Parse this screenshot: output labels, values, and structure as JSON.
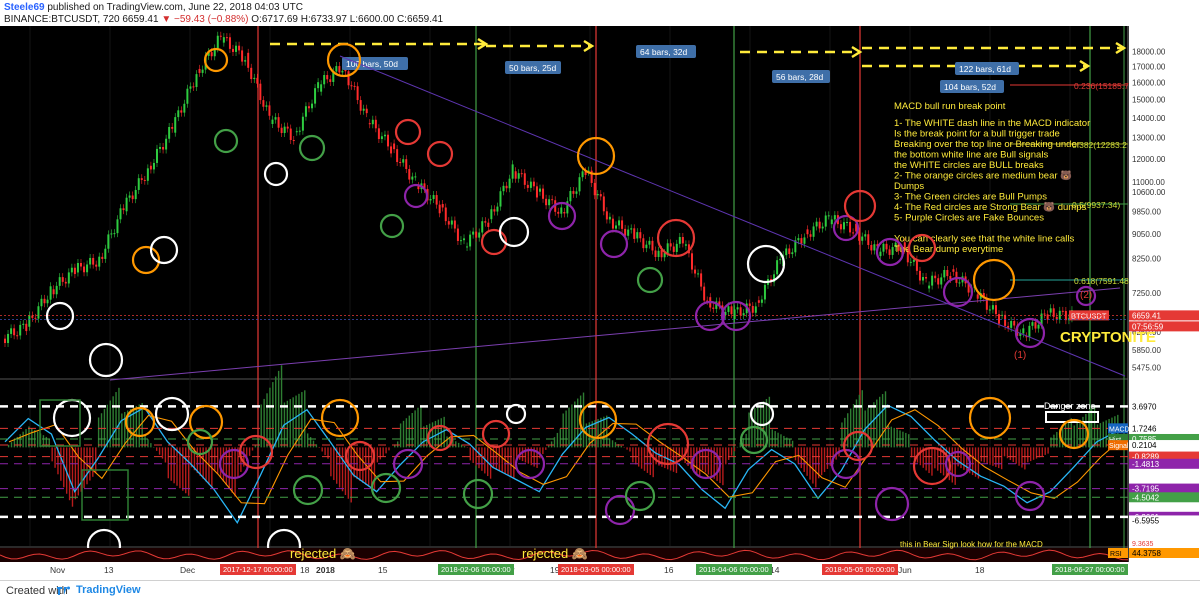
{
  "header": {
    "author": "Steele69",
    "published": "published on TradingView.com, June 22, 2018 04:03 UTC",
    "symbol": "BINANCE:BTCUSDT, 720",
    "last": "6659.41",
    "change": "▼ −59.43 (−0.88%)",
    "ohlc": "O:6717.69 H:6733.97 L:6600.00 C:6659.41"
  },
  "footer": {
    "made_with": "Created with",
    "brand": "TradingView"
  },
  "chart_data": {
    "type": "line",
    "price_axis": [
      "18000.00",
      "16000.00",
      "15000.00",
      "14000.00",
      "13000.00",
      "12000.00",
      "11000.00",
      "10600.00",
      "9850.00",
      "9050.00",
      "8250.00",
      "7950.00",
      "7250.00",
      "6600.00",
      "6250.00",
      "5850.00",
      "5475.00"
    ],
    "price_axis_short": [
      "18000.00",
      "17000.00",
      "16000.00",
      "15000.00",
      "14000.00",
      "13000.00",
      "12000.00",
      "11000.00",
      "10600.00",
      "9850.00",
      "9050.00",
      "8250.00",
      "7250.00",
      "6600.00",
      "6250.00",
      "5850.00",
      "5475.00"
    ],
    "time_axis": [
      "Nov",
      "13",
      "Dec",
      "18",
      "2018",
      "15",
      "Feb",
      "Mar",
      "19",
      "Apr",
      "16",
      "May",
      "14",
      "Jun",
      "18"
    ],
    "time_marks": [
      {
        "label": "2017-12-17 00:00:00",
        "color": "#e53935"
      },
      {
        "label": "2018-02-06 00:00:00",
        "color": "#43a047"
      },
      {
        "label": "2018-03-05 00:00:00",
        "color": "#e53935"
      },
      {
        "label": "2018-04-06 00:00:00",
        "color": "#43a047"
      },
      {
        "label": "2018-05-05 00:00:00",
        "color": "#e53935"
      },
      {
        "label": "2018-06-27 00:00:00",
        "color": "#43a047"
      }
    ],
    "bar_labels": [
      "100 bars, 50d",
      "50 bars, 25d",
      "64 bars, 32d",
      "56 bars, 28d",
      "122 bars, 61d",
      "104 bars, 52d"
    ],
    "fib_levels": [
      "0.236(15185.7",
      "0.382(12283.2",
      "0.5(9937.34)",
      "0.618(7591.48"
    ],
    "price_tags": {
      "symbol": "BTCUSDT",
      "price": "6659.41",
      "timer": "07:56:59"
    },
    "annotation": {
      "title": "MACD bull run break point",
      "lines": [
        "1- The WHITE dash line in the MACD indicator",
        "Is the break point for a bull trigger trade",
        "Breaking over the top line or Breaking under",
        "the bottom white line are Bull signals",
        "the WHITE circles are BULL breaks",
        "2- The orange circles are medium bear 🐻",
        "Dumps",
        "3- The Green circles are Bull Pumps",
        "4- The Red circles are Strong Bear 🐻 dumps",
        "5- Purple Circles are Fake Bounces",
        "",
        "You can clearly see that the white line calls",
        "The Bear dump everytime"
      ]
    },
    "logo_text": "CRYPTONITE",
    "wave_labels": [
      "(1)",
      "(2)"
    ],
    "macd_axis": [
      {
        "label": "3.6970",
        "bg": "#ffffff",
        "fg": "#000000"
      },
      {
        "label": "1.7246",
        "bg": "#ffffff",
        "fg": "#000000"
      },
      {
        "label": "0.7585",
        "bg": "#43a047",
        "fg": "#ffffff"
      },
      {
        "label": "0.2104",
        "bg": "#ffffff",
        "fg": "#000000"
      },
      {
        "label": "-0.8289",
        "bg": "#e53935",
        "fg": "#ffffff"
      },
      {
        "label": "-1.4813",
        "bg": "#8e24aa",
        "fg": "#ffffff"
      },
      {
        "label": "-3.7195",
        "bg": "#8e24aa",
        "fg": "#ffffff"
      },
      {
        "label": "-4.5042",
        "bg": "#43a047",
        "fg": "#ffffff"
      },
      {
        "label": "-6.2661",
        "bg": "#8e24aa",
        "fg": "#ffffff"
      },
      {
        "label": "-6.5955",
        "bg": "#ffffff",
        "fg": "#000000"
      }
    ],
    "macd_legend": [
      "MACD",
      "Hist",
      "Signal"
    ],
    "danger_zone": "Danger zone",
    "rsi": {
      "label": "RSI",
      "value": "44.3758",
      "low": "9.3635"
    },
    "rejected": [
      "rejected 🙈",
      "rejected 🙈"
    ],
    "rsi_note": "this in Bear Sign look how for the MACD",
    "price_series": [
      6100,
      6400,
      7300,
      7900,
      8200,
      10000,
      11500,
      13500,
      16500,
      19000,
      17500,
      14000,
      13000,
      15800,
      17000,
      14000,
      12500,
      11000,
      10000,
      8700,
      9500,
      11500,
      10600,
      9800,
      11500,
      9500,
      9000,
      8400,
      8800,
      7000,
      6700,
      6900,
      8200,
      9000,
      9600,
      9200,
      8500,
      8600,
      7500,
      7800,
      7300,
      6600,
      6200,
      6700,
      6650
    ],
    "macd_series": [
      0.5,
      2.6,
      1.2,
      -4,
      -1,
      2.4,
      3.6,
      0.5,
      -1.5,
      -3.8,
      -6.8,
      -2.5,
      2,
      3.4,
      0.5,
      -2.5,
      -4,
      -1.6,
      0.5,
      1.6,
      0.3,
      -1.8,
      -2.9,
      -4,
      -0.6,
      1.8,
      2.7,
      1.2,
      -0.5,
      -1.5,
      -3.8,
      -5.5,
      -2,
      -0.2,
      -1.5,
      -4.6,
      -2.1,
      1.6,
      3.8,
      2.8,
      0.7,
      -1.2,
      -2.6,
      -3.5,
      -5,
      -4,
      -1.8,
      0.5,
      1.6
    ]
  }
}
